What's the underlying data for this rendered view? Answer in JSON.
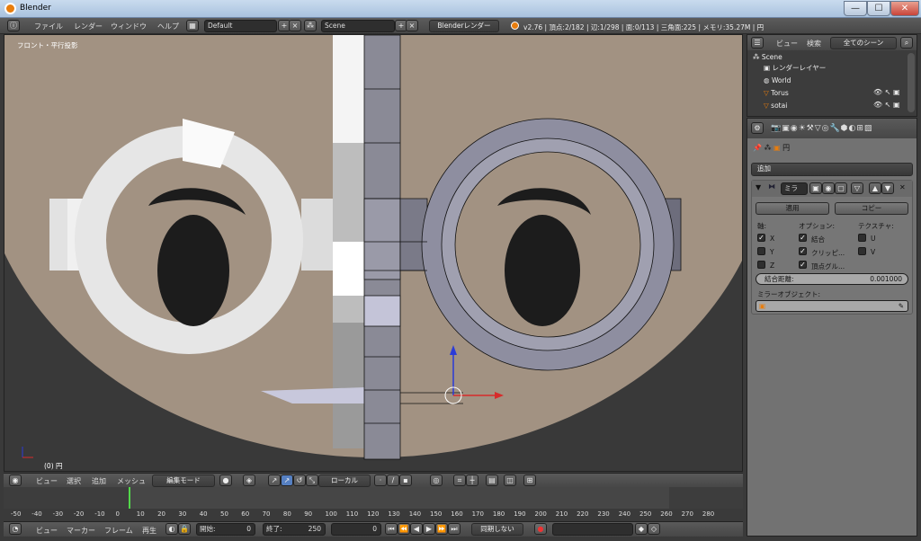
{
  "window": {
    "title": "Blender",
    "min": "—",
    "max": "☐",
    "close": "✕"
  },
  "info_header": {
    "menus": [
      "ファイル",
      "レンダー",
      "ウィンドウ",
      "ヘルプ"
    ],
    "layout": "Default",
    "scene": "Scene",
    "engine": "Blenderレンダー",
    "stats": "v2.76 | 頂点:2/182 | 辺:1/298 | 面:0/113 | 三角面:225 | メモリ:35.27M | 円"
  },
  "viewport": {
    "view_label": "フロント・平行投影",
    "frame_label": "(0) 円"
  },
  "view3d_header": {
    "menus": [
      "ビュー",
      "選択",
      "追加",
      "メッシュ"
    ],
    "mode": "編集モード",
    "orientation": "ローカル"
  },
  "timeline": {
    "ticks": [
      "-50",
      "-40",
      "-30",
      "-20",
      "-10",
      "0",
      "10",
      "20",
      "30",
      "40",
      "50",
      "60",
      "70",
      "80",
      "90",
      "100",
      "110",
      "120",
      "130",
      "140",
      "150",
      "160",
      "170",
      "180",
      "190",
      "200",
      "210",
      "220",
      "230",
      "240",
      "250",
      "260",
      "270",
      "280"
    ]
  },
  "bottom_header": {
    "menus": [
      "ビュー",
      "マーカー",
      "フレーム",
      "再生"
    ],
    "start_label": "開始:",
    "start": "0",
    "end_label": "終了:",
    "end": "250",
    "current": "0",
    "sync": "同期しない"
  },
  "outliner": {
    "menus": [
      "ビュー",
      "検索"
    ],
    "filter": "全てのシーン",
    "rows": [
      {
        "label": "Scene"
      },
      {
        "label": "レンダーレイヤー"
      },
      {
        "label": "World"
      },
      {
        "label": "Torus"
      },
      {
        "label": "sotai"
      }
    ]
  },
  "properties": {
    "object_name": "円",
    "add_modifier": "追加",
    "modifier_name": "ミラ",
    "apply": "適用",
    "copy": "コピー",
    "axis_title": "軸:",
    "options_title": "オプション:",
    "texture_title": "テクスチャ:",
    "axes": [
      "X",
      "Y",
      "Z"
    ],
    "options": [
      "結合",
      "クリッピ...",
      "頂点グル..."
    ],
    "textures": [
      "U",
      "V"
    ],
    "merge_label": "結合距離:",
    "merge_value": "0.001000",
    "mirror_object_label": "ミラーオブジェクト:"
  },
  "colors": {
    "accent": "#e87d0d",
    "skin": "#a29282",
    "selected_face": "#8c8c9a",
    "background": "#393939"
  }
}
